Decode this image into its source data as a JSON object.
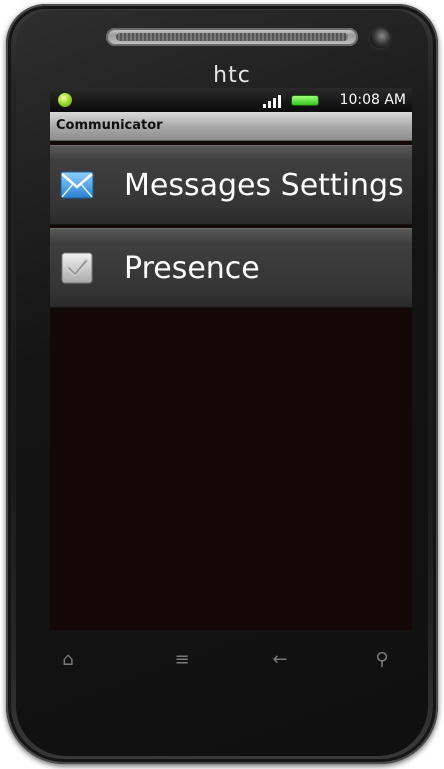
{
  "device": {
    "brand_text": "htc"
  },
  "status_bar": {
    "time": "10:08 AM",
    "notification_icon": "green-dot-icon",
    "signal_icon": "signal-bars-icon",
    "battery_icon": "battery-icon"
  },
  "title_bar": {
    "title": "Communicator"
  },
  "settings_list": {
    "items": [
      {
        "label": "Messages Settings",
        "icon": "envelope-icon"
      },
      {
        "label": "Presence",
        "icon": "checkbox-icon",
        "checked": true
      }
    ]
  },
  "nav_keys": [
    {
      "name": "home",
      "glyph": "⌂"
    },
    {
      "name": "menu",
      "glyph": "≡"
    },
    {
      "name": "back",
      "glyph": "←"
    },
    {
      "name": "search",
      "glyph": "⚲"
    }
  ],
  "colors": {
    "screen_background": "#140707",
    "list_item_background": "#3a3a3a",
    "title_bar_background": "#b3b3b3",
    "text_primary": "#ffffff",
    "battery_green": "#35c41d"
  }
}
